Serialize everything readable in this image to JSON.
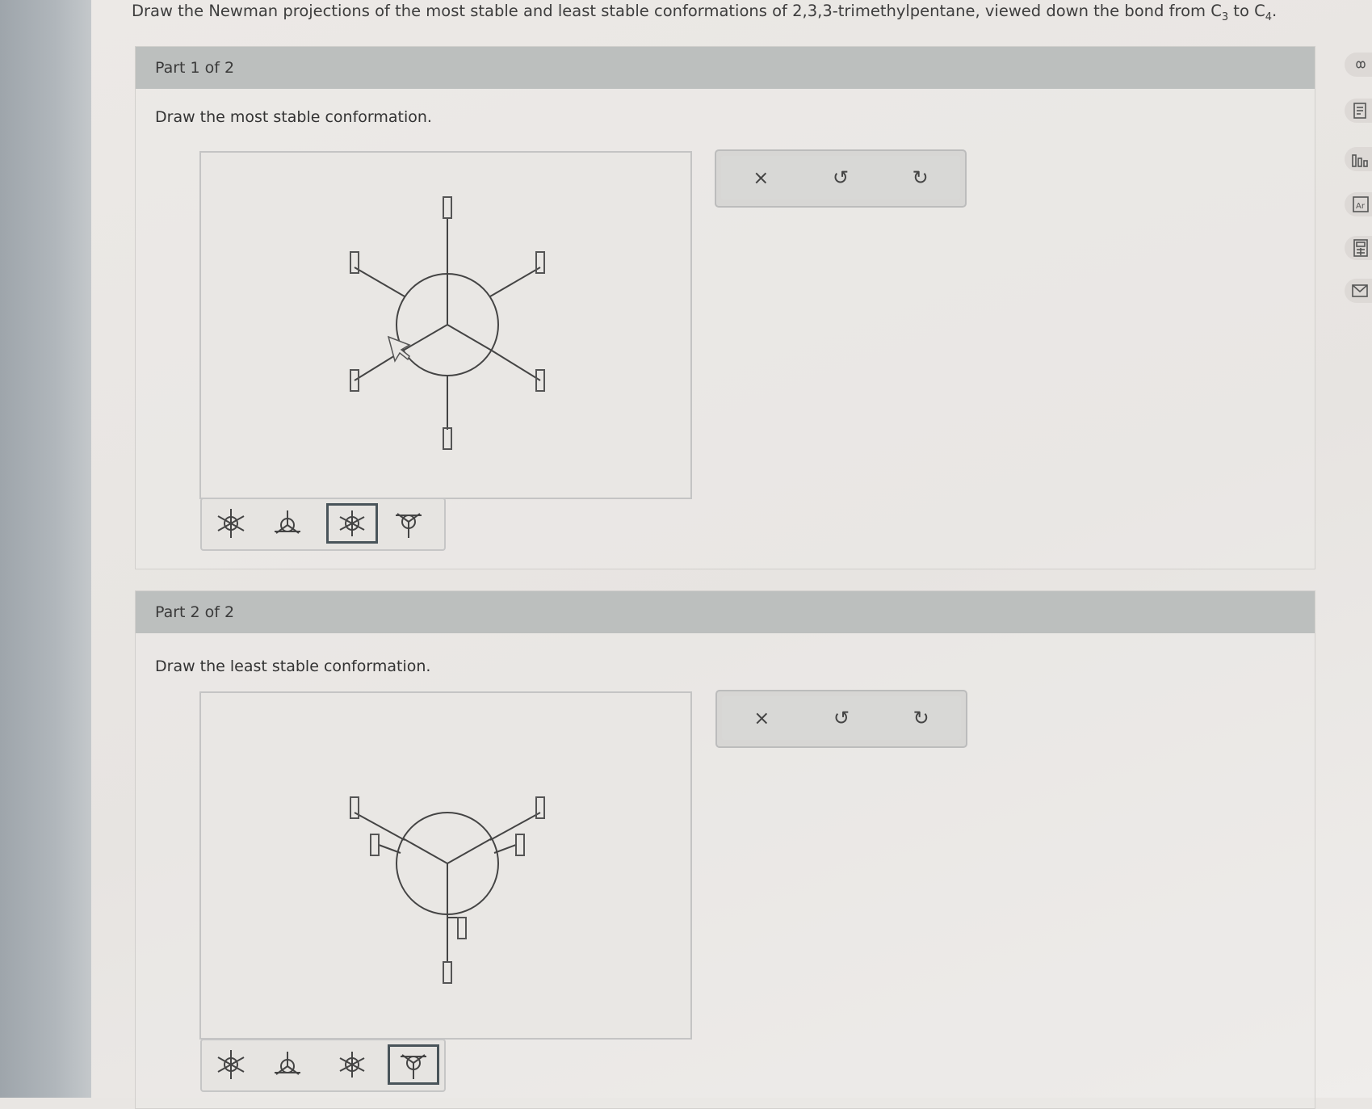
{
  "question": {
    "prefix": "Draw the Newman projections of the most stable and least stable conformations of 2,3,3-trimethylpentane, viewed down the bond from C",
    "sub1": "3",
    "middle": " to C",
    "sub2": "4",
    "suffix": "."
  },
  "parts": [
    {
      "header": "Part 1 of 2",
      "instruction": "Draw the most stable conformation.",
      "selected_template": 2
    },
    {
      "header": "Part 2 of 2",
      "instruction": "Draw the least stable conformation.",
      "selected_template": 3
    }
  ],
  "toolbar": {
    "clear_icon": "×",
    "undo_icon": "↺",
    "redo_icon": "↻"
  },
  "templates": [
    "staggered-template-icon",
    "eclipsed-template-icon",
    "staggered-rotated-template-icon",
    "eclipsed-rotated-template-icon"
  ],
  "side_icons": [
    "infinity-icon",
    "document-icon",
    "bar-chart-icon",
    "periodic-table-icon",
    "calculator-icon",
    "mail-icon"
  ],
  "colors": {
    "header_bg": "#bcbfbe",
    "selected_border": "#49545a"
  }
}
